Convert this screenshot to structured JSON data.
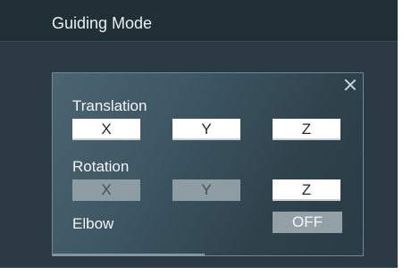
{
  "window": {
    "title": "Guiding Mode"
  },
  "dialog": {
    "close_label": "×",
    "translation": {
      "label": "Translation",
      "x": "X",
      "y": "Y",
      "z": "Z"
    },
    "rotation": {
      "label": "Rotation",
      "x": "X",
      "y": "Y",
      "z": "Z"
    },
    "elbow": {
      "label": "Elbow",
      "value": "OFF"
    }
  },
  "colors": {
    "title_bar": "#212f37",
    "background": "#2c3b43",
    "dialog_gradient_start": "#4a6470",
    "dialog_gradient_end": "#2a3c45",
    "button_active": "#ffffff",
    "button_inactive": "#8e9da3",
    "label_text": "#f2f5f6"
  },
  "states": {
    "translation_x": "active",
    "translation_y": "active",
    "translation_z": "active",
    "rotation_x": "inactive",
    "rotation_y": "inactive",
    "rotation_z": "active",
    "elbow": "off"
  }
}
